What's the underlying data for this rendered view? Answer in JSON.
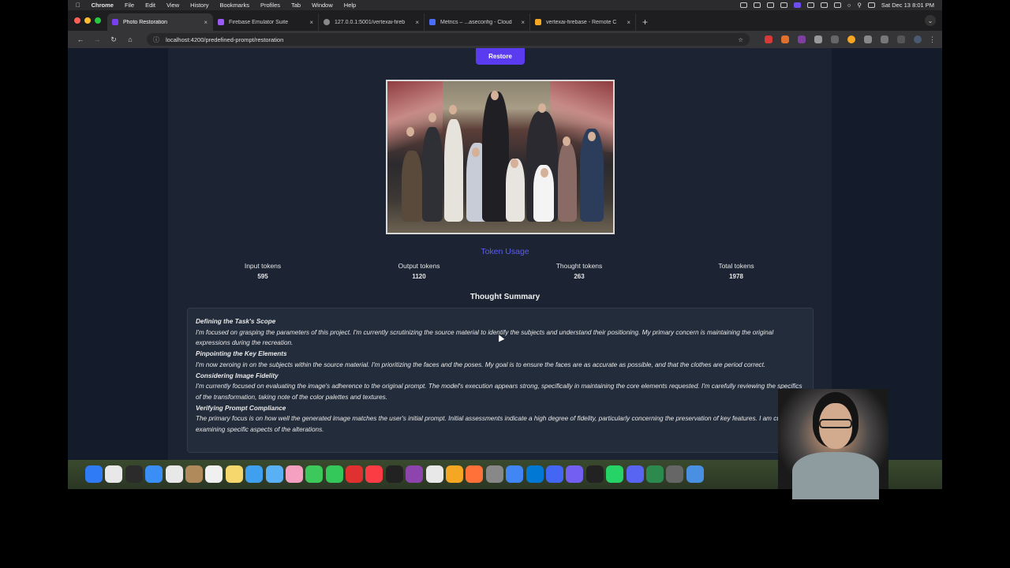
{
  "menubar": {
    "app_name": "Chrome",
    "menus": [
      "File",
      "Edit",
      "View",
      "History",
      "Bookmarks",
      "Profiles",
      "Tab",
      "Window",
      "Help"
    ],
    "clock": "Sat Dec 13  8:01 PM"
  },
  "tabs": [
    {
      "label": "Photo Restoration",
      "favicon_color": "#7a3ff0",
      "active": true
    },
    {
      "label": "Firebase Emulator Suite",
      "favicon_color": "#9b59f5",
      "active": false
    },
    {
      "label": "127.0.0.1:5001/vertexai-fireb",
      "favicon_color": "#888888",
      "active": false
    },
    {
      "label": "Metrics – ...aseconfig - Cloud",
      "favicon_color": "#4b6cf5",
      "active": false
    },
    {
      "label": "vertexai-firebase - Remote C",
      "favicon_color": "#f5a623",
      "active": false
    }
  ],
  "toolbar": {
    "url": "localhost:4200/predefined-prompt/restoration"
  },
  "page": {
    "restore_button": "Restore",
    "token_usage_title": "Token Usage",
    "stats": [
      {
        "label": "Input tokens",
        "value": "595"
      },
      {
        "label": "Output tokens",
        "value": "1120"
      },
      {
        "label": "Thought tokens",
        "value": "263"
      },
      {
        "label": "Total tokens",
        "value": "1978"
      }
    ],
    "thought_summary_title": "Thought Summary",
    "summary": [
      {
        "heading": "Defining the Task's Scope",
        "text": "I'm focused on grasping the parameters of this project. I'm currently scrutinizing the source material to identify the subjects and understand their positioning. My primary concern is maintaining the original expressions during the recreation."
      },
      {
        "heading": "Pinpointing the Key Elements",
        "text": "I'm now zeroing in on the subjects within the source material. I'm prioritizing the faces and the poses. My goal is to ensure the faces are as accurate as possible, and that the clothes are period correct."
      },
      {
        "heading": "Considering Image Fidelity",
        "text": "I'm currently focused on evaluating the image's adherence to the original prompt. The model's execution appears strong, specifically in maintaining the core elements requested. I'm carefully reviewing the specifics of the transformation, taking note of the color palettes and textures."
      },
      {
        "heading": "Verifying Prompt Compliance",
        "text": "The primary focus is on how well the generated image matches the user's initial prompt. Initial assessments indicate a high degree of fidelity, particularly concerning the preservation of key features. I am currently examining specific aspects of the alterations."
      }
    ]
  },
  "dock_colors": [
    "#2f7bf5",
    "#e8e8e8",
    "#2b2b2b",
    "#3a8ef5",
    "#e8e8e8",
    "#b08a5a",
    "#f0f0f0",
    "#f5d76e",
    "#3fa0f0",
    "#5ab0f5",
    "#f5a0c0",
    "#3cc85a",
    "#34c759",
    "#e03030",
    "#fc3c44",
    "#222222",
    "#8e44ad",
    "#e8e8e8",
    "#f5a623",
    "#ff7139",
    "#888888",
    "#4285f4",
    "#0078d4",
    "#4466f5",
    "#7360f2",
    "#222222",
    "#25d366",
    "#5865f2",
    "#2d8a4e",
    "#666666",
    "#4a90e2"
  ]
}
